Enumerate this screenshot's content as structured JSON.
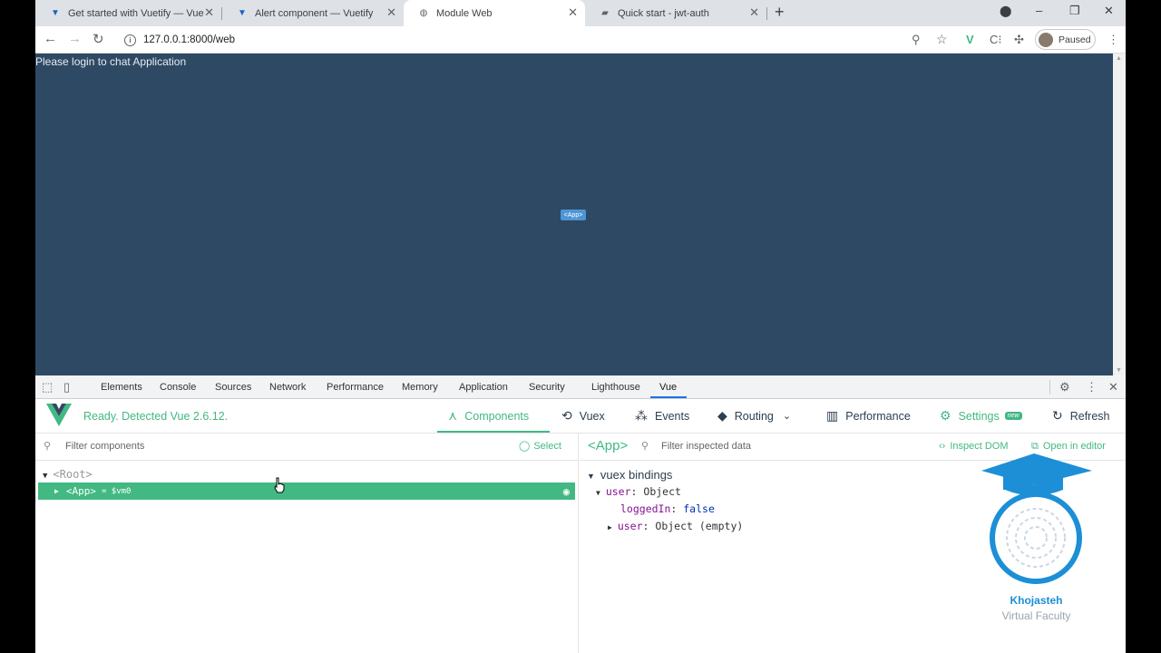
{
  "tabs": [
    {
      "title": "Get started with Vuetify — Vuetify",
      "active": false
    },
    {
      "title": "Alert component — Vuetify",
      "active": false
    },
    {
      "title": "Module Web",
      "active": true
    },
    {
      "title": "Quick start - jwt-auth",
      "active": false
    }
  ],
  "address_bar": {
    "url": "127.0.0.1:8000/web"
  },
  "profile": {
    "status": "Paused"
  },
  "page": {
    "login_message": "Please login to chat Application",
    "app_badge": "<App>"
  },
  "devtools": {
    "tabs": [
      "Elements",
      "Console",
      "Sources",
      "Network",
      "Performance",
      "Memory",
      "Application",
      "Security",
      "Lighthouse",
      "Vue"
    ],
    "active_tab": "Vue",
    "vue": {
      "status": "Ready. Detected Vue 2.6.12.",
      "nav": {
        "components": "Components",
        "vuex": "Vuex",
        "events": "Events",
        "routing": "Routing",
        "performance": "Performance",
        "settings": "Settings",
        "settings_badge": "new",
        "refresh": "Refresh"
      },
      "left": {
        "filter_placeholder": "Filter components",
        "select_label": "Select",
        "root_label": "<Root>",
        "app_label": "<App>",
        "app_vm": "= $vm0"
      },
      "right": {
        "component_tag": "<App>",
        "filter_placeholder": "Filter inspected data",
        "inspect_dom": "Inspect DOM",
        "open_in_editor": "Open in editor",
        "section_title": "vuex bindings",
        "line1_key": "user",
        "line1_val": "Object",
        "line2_key": "loggedIn",
        "line2_val": "false",
        "line3_key": "user",
        "line3_val": "Object (empty)"
      }
    }
  },
  "watermark": {
    "name": "Khojasteh",
    "subtitle": "Virtual Faculty"
  },
  "colors": {
    "vue_green": "#42b883",
    "page_bg": "#2e4964",
    "watermark_blue": "#1c8fd6"
  }
}
